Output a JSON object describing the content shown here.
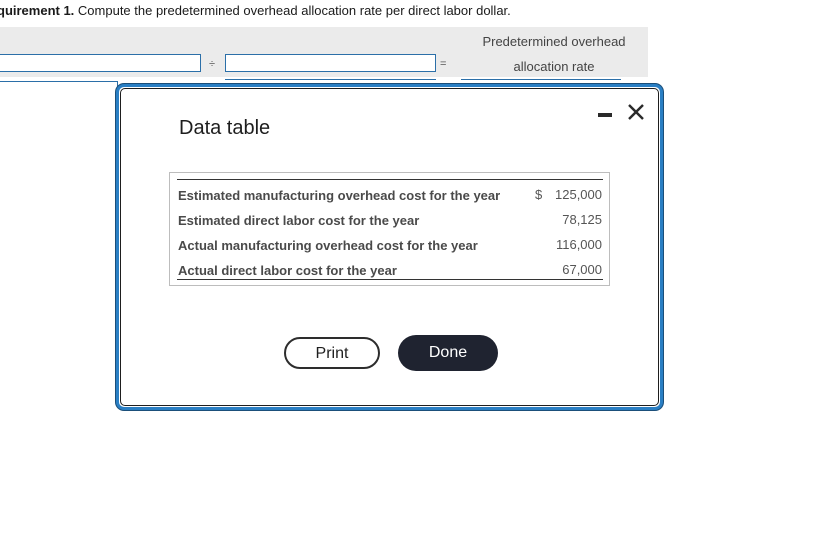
{
  "requirement": {
    "prefix": "quirement 1.",
    "text": " Compute the predetermined overhead allocation rate per direct labor dollar."
  },
  "formula": {
    "divide_symbol": "÷",
    "equals_symbol": "=",
    "result_header_line1": "Predetermined overhead",
    "result_header_line2": "allocation rate"
  },
  "modal": {
    "title": "Data table",
    "rows": [
      {
        "label": "Estimated manufacturing overhead cost for the year",
        "currency": "$",
        "value": "125,000"
      },
      {
        "label": "Estimated direct labor cost for the year",
        "currency": "",
        "value": "78,125"
      },
      {
        "label": "Actual manufacturing overhead cost for the year",
        "currency": "",
        "value": "116,000"
      },
      {
        "label": "Actual direct labor cost for the year",
        "currency": "",
        "value": "67,000"
      }
    ],
    "print_label": "Print",
    "done_label": "Done"
  },
  "colors": {
    "accent_border": "#2a7fc4",
    "done_button_bg": "#1f2330",
    "formula_band_bg": "#ebebeb"
  },
  "icons": {
    "minimize": "minimize-icon",
    "close": "close-icon"
  }
}
